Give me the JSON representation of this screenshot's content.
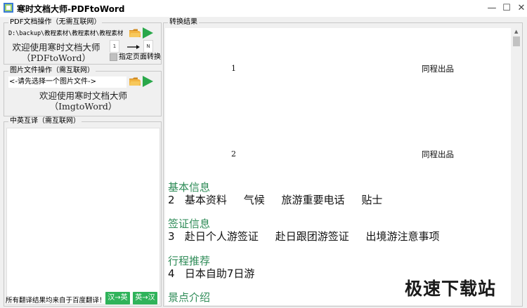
{
  "window": {
    "title": "寒时文档大师-PDFtoWord",
    "minimize_icon": "minimize-icon",
    "maximize_icon": "maximize-icon",
    "close_icon": "close-icon"
  },
  "pdf_group": {
    "title": "PDF文档操作（无需互联网）",
    "path": "D:\\backup\\教程素材\\教程素材\\教程素材",
    "welcome_line1": "欢迎使用寒时文档大师",
    "welcome_line2": "（PDFtoWord）",
    "page_from": "1",
    "page_to": "N",
    "page_convert_label": "指定页面转换"
  },
  "img_group": {
    "title": "图片文件操作（需互联网）",
    "select_placeholder": "<-请先选择一个图片文件->",
    "welcome_line1": "欢迎使用寒时文档大师",
    "welcome_line2": "（ImgtoWord）"
  },
  "translate_group": {
    "title": "中英互译（需互联网）",
    "text": "",
    "footer_note": "所有翻译结果均来自于百度翻译！",
    "btn_cn_en": "汉→英",
    "btn_en_cn": "英→汉"
  },
  "result": {
    "title": "转换结果",
    "page1_number": "1",
    "page1_org": "同程出品",
    "page2_number": "2",
    "page2_org": "同程出品",
    "sections": [
      {
        "head": "基本信息",
        "body": "2   基本资料     气候     旅游重要电话     贴士"
      },
      {
        "head": "签证信息",
        "body": "3   赴日个人游签证     赴日跟团游签证     出境游注意事项"
      },
      {
        "head": "行程推荐",
        "body": "4   日本自助7日游"
      },
      {
        "head": "景点介绍",
        "body": ""
      }
    ]
  },
  "watermark": "极速下载站",
  "colors": {
    "green_button": "#2fb35a",
    "section_heading": "#2e8b57",
    "play_icon": "#2aa84a",
    "folder_icon": "#e8a33a"
  }
}
